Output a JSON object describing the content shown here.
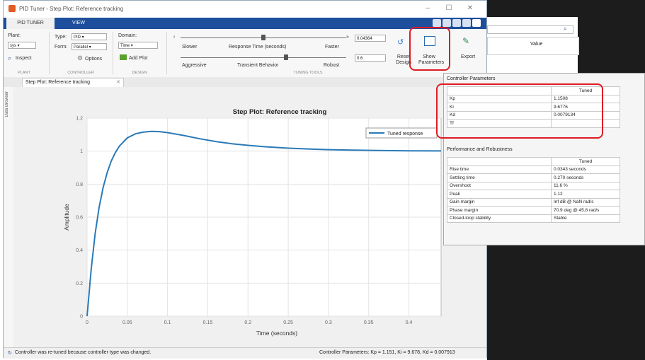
{
  "window": {
    "title": "PID Tuner - Step Plot: Reference tracking",
    "controls": [
      "–",
      "☐",
      "✕"
    ]
  },
  "ribbon": {
    "tabs": [
      {
        "label": "PID TUNER"
      },
      {
        "label": "VIEW"
      }
    ],
    "plant": {
      "label": "Plant:",
      "value": "sys",
      "inspect": "Inspect"
    },
    "type": {
      "label": "Type:",
      "value": "PID"
    },
    "form": {
      "label": "Form:",
      "value": "Parallel"
    },
    "options": "Options",
    "domain": {
      "label": "Domain:",
      "value": "Time"
    },
    "add_plot": "Add Plot",
    "response_time": {
      "left": "Slower",
      "center": "Response Time (seconds)",
      "right": "Faster",
      "value": "0.04364"
    },
    "transient": {
      "left": "Aggressive",
      "center": "Transient Behavior",
      "right": "Robust",
      "value": "0.6"
    },
    "reset_design": "Reset Design",
    "show_parameters": "Show Parameters",
    "export": "Export",
    "sections": [
      "PLANT",
      "CONTROLLER",
      "DESIGN",
      "TUNING TOOLS"
    ]
  },
  "doc_tab": {
    "label": "Step Plot: Reference tracking",
    "close": "✕"
  },
  "data_browser": "Data Browser",
  "plot": {
    "legend": "Tuned response"
  },
  "chart_data": {
    "type": "line",
    "title": "Step Plot: Reference tracking",
    "xlabel": "Time (seconds)",
    "ylabel": "Amplitude",
    "xlim": [
      0,
      0.44
    ],
    "ylim": [
      0,
      1.2
    ],
    "xticks": [
      "0",
      "0.05",
      "0.1",
      "0.15",
      "0.2",
      "0.25",
      "0.3",
      "0.35",
      "0.4"
    ],
    "yticks": [
      "0",
      "0.2",
      "0.4",
      "0.6",
      "0.8",
      "1",
      "1.2"
    ],
    "grid": true,
    "legend_position": "top-right",
    "color": "#2a7ab8",
    "series": [
      {
        "name": "Tuned response",
        "x": [
          0,
          0.005,
          0.01,
          0.015,
          0.02,
          0.025,
          0.03,
          0.035,
          0.04,
          0.05,
          0.06,
          0.07,
          0.08,
          0.09,
          0.1,
          0.12,
          0.14,
          0.16,
          0.18,
          0.2,
          0.22,
          0.25,
          0.28,
          0.3,
          0.33,
          0.36,
          0.4,
          0.44
        ],
        "y": [
          0,
          0.28,
          0.5,
          0.66,
          0.78,
          0.87,
          0.94,
          0.99,
          1.03,
          1.08,
          1.105,
          1.115,
          1.12,
          1.118,
          1.112,
          1.095,
          1.075,
          1.058,
          1.045,
          1.035,
          1.027,
          1.018,
          1.012,
          1.009,
          1.006,
          1.004,
          1.002,
          1.001
        ]
      }
    ]
  },
  "status": {
    "left": "Controller was re-tuned because controller type was changed.",
    "right": "Controller Parameters: Kp = 1.151, Ki = 9.678, Kd = 0.007913"
  },
  "workspace": {
    "value_header": "Value"
  },
  "controller_parameters": {
    "title": "Controller Parameters",
    "column": "Tuned",
    "rows": [
      {
        "name": "Kp",
        "value": "1.1508"
      },
      {
        "name": "Ki",
        "value": "9.6776"
      },
      {
        "name": "Kd",
        "value": "0.0079134"
      },
      {
        "name": "Tf",
        "value": ""
      }
    ]
  },
  "performance": {
    "title": "Performance and Robustness",
    "column": "Tuned",
    "rows": [
      {
        "name": "Rise time",
        "value": "0.0343 seconds"
      },
      {
        "name": "Settling time",
        "value": "0.270 seconds"
      },
      {
        "name": "Overshoot",
        "value": "11.6 %"
      },
      {
        "name": "Peak",
        "value": "1.12"
      },
      {
        "name": "Gain margin",
        "value": "Inf dB @ NaN rad/s"
      },
      {
        "name": "Phase margin",
        "value": "70.9 deg @ 45.8 rad/s"
      },
      {
        "name": "Closed-loop stability",
        "value": "Stable"
      }
    ]
  }
}
